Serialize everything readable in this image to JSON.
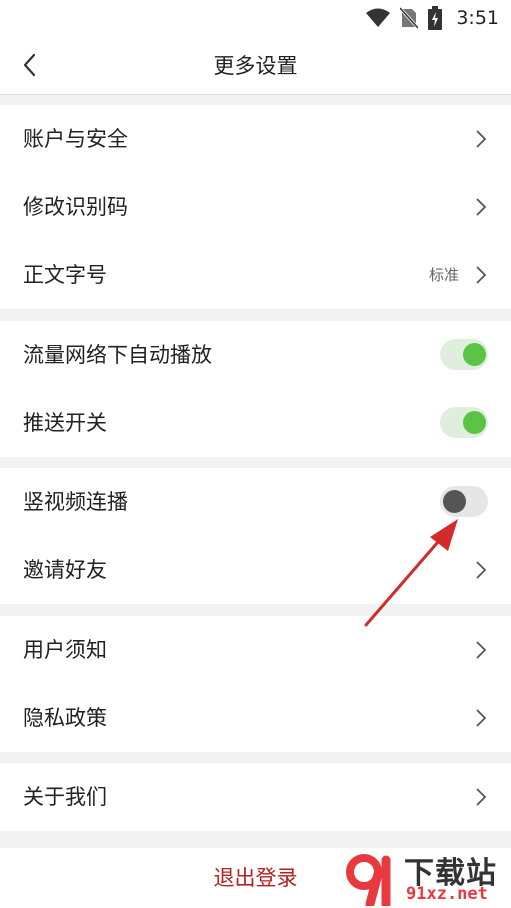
{
  "status_bar": {
    "time": "3:51"
  },
  "header": {
    "title": "更多设置"
  },
  "groups": [
    {
      "items": [
        {
          "label": "账户与安全"
        },
        {
          "label": "修改识别码"
        },
        {
          "label": "正文字号",
          "value": "标准"
        }
      ]
    },
    {
      "items": [
        {
          "label": "流量网络下自动播放",
          "toggle": "on"
        },
        {
          "label": "推送开关",
          "toggle": "on"
        }
      ]
    },
    {
      "items": [
        {
          "label": "竖视频连播",
          "toggle": "off"
        },
        {
          "label": "邀请好友"
        }
      ]
    },
    {
      "items": [
        {
          "label": "用户须知"
        },
        {
          "label": "隐私政策"
        }
      ]
    },
    {
      "items": [
        {
          "label": "关于我们"
        }
      ]
    }
  ],
  "logout": {
    "label": "退出登录"
  },
  "watermark": {
    "title": "下载站",
    "site": "91xz.net"
  },
  "colors": {
    "toggle_on": "#5cc346",
    "toggle_off_knob": "#555555",
    "logout_text": "#b22222",
    "annotation_arrow": "#d42a2a"
  }
}
